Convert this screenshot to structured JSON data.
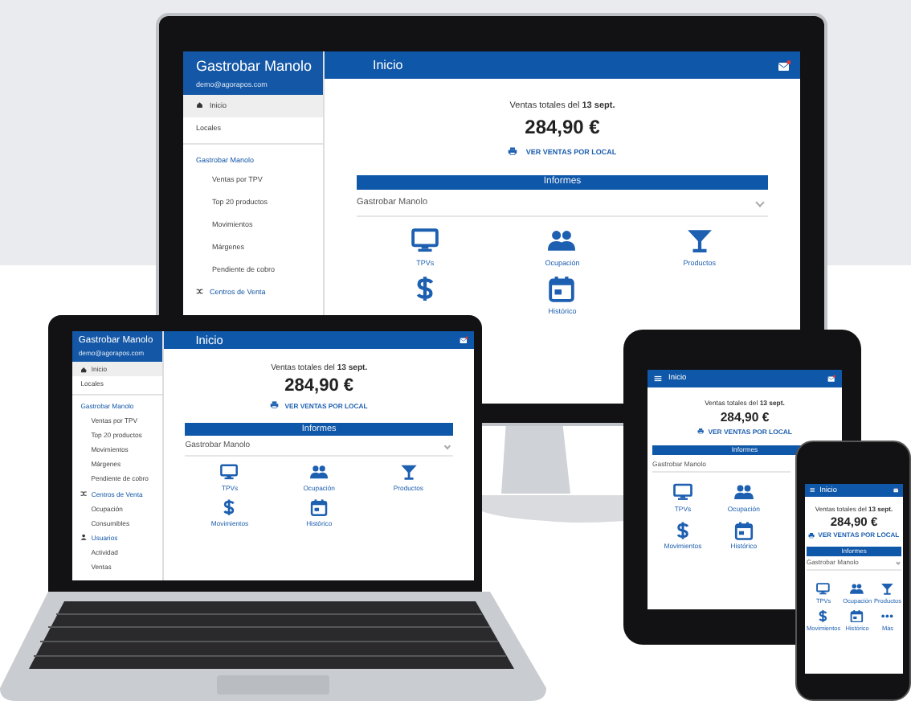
{
  "monitor": {
    "brand": "Gastrobar Manolo",
    "user": "demo@agorapos.com",
    "title": "Inicio",
    "nav": [
      {
        "kind": "item",
        "label": "Inicio",
        "selected": true
      },
      {
        "kind": "item",
        "label": "Locales",
        "selected": false
      },
      {
        "kind": "section",
        "label": "Gastrobar Manolo"
      },
      {
        "kind": "subitem",
        "label": "Ventas por TPV",
        "selected": false
      },
      {
        "kind": "subitem",
        "label": "Top 20 productos",
        "selected": false
      },
      {
        "kind": "subitem",
        "label": "Movimientos",
        "selected": false
      },
      {
        "kind": "subitem",
        "label": "Márgenes",
        "selected": false
      },
      {
        "kind": "subitem",
        "label": "Pendiente de cobro",
        "selected": false
      },
      {
        "kind": "group",
        "label": "Centros de Venta"
      }
    ],
    "sales_label": "Ventas totales del **13 sept.**",
    "total": "284,90 €",
    "link": "VER VENTAS POR LOCAL",
    "reports_title": "Informes",
    "venue": "Gastrobar Manolo",
    "tiles": [
      {
        "kind": "monitor",
        "label": "TPVs"
      },
      {
        "kind": "people",
        "label": "Ocupación"
      },
      {
        "kind": "glass",
        "label": "Productos"
      },
      {
        "kind": "dollar"
      },
      {
        "kind": "calendar",
        "label": "Histórico"
      }
    ]
  },
  "laptop": {
    "brand": "Gastrobar Manolo",
    "user": "demo@agorapos.com",
    "title": "Inicio",
    "nav": [
      {
        "kind": "item",
        "label": "Inicio",
        "selected": true
      },
      {
        "kind": "item",
        "label": "Locales",
        "selected": false
      },
      {
        "kind": "section",
        "label": "Gastrobar Manolo"
      },
      {
        "kind": "subitem",
        "label": "Ventas por TPV",
        "selected": false
      },
      {
        "kind": "subitem",
        "label": "Top 20 productos",
        "selected": false
      },
      {
        "kind": "subitem",
        "label": "Movimientos",
        "selected": false
      },
      {
        "kind": "subitem",
        "label": "Márgenes",
        "selected": false
      },
      {
        "kind": "subitem",
        "label": "Pendiente de cobro",
        "selected": false
      },
      {
        "kind": "group",
        "label": "Centros de Venta"
      },
      {
        "kind": "subitem",
        "label": "Ocupación",
        "selected": false
      },
      {
        "kind": "subitem",
        "label": "Consumibles",
        "selected": false
      },
      {
        "kind": "group",
        "label": "Usuarios"
      },
      {
        "kind": "subitem",
        "label": "Actividad",
        "selected": false
      },
      {
        "kind": "subitem",
        "label": "Ventas",
        "selected": false
      }
    ],
    "sales_label": "Ventas totales del **13 sept.**",
    "total": "284,90 €",
    "link": "VER VENTAS POR LOCAL",
    "reports_title": "Informes",
    "venue": "Gastrobar Manolo",
    "tiles": [
      {
        "kind": "monitor",
        "label": "TPVs"
      },
      {
        "kind": "people",
        "label": "Ocupación"
      },
      {
        "kind": "glass",
        "label": "Productos"
      },
      {
        "kind": "dollar",
        "label": "Movimientos"
      },
      {
        "kind": "calendar",
        "label": "Histórico"
      }
    ]
  },
  "tablet": {
    "title": "Inicio",
    "sales_label": "Ventas totales del **13 sept.**",
    "total": "284,90 €",
    "link": "VER VENTAS POR LOCAL",
    "reports_title": "Informes",
    "venue": "Gastrobar Manolo",
    "tiles": [
      {
        "kind": "monitor",
        "label": "TPVs"
      },
      {
        "kind": "people",
        "label": "Ocupación"
      },
      {
        "kind": "dollar",
        "label": "Movimientos"
      },
      {
        "kind": "calendar",
        "label": "Histórico"
      }
    ]
  },
  "phone": {
    "title": "Inicio",
    "sales_label": "Ventas totales del **13 sept.**",
    "total": "284,90 €",
    "link": "VER VENTAS POR LOCAL",
    "reports_title": "Informes",
    "venue": "Gastrobar Manolo",
    "tiles": [
      {
        "kind": "monitor",
        "label": "TPVs"
      },
      {
        "kind": "people",
        "label": "Ocupación"
      },
      {
        "kind": "glass",
        "label": "Productos"
      },
      {
        "kind": "dollar",
        "label": "Movimientos"
      },
      {
        "kind": "calendar",
        "label": "Histórico"
      },
      {
        "kind": "dots",
        "label": "Más"
      }
    ]
  }
}
